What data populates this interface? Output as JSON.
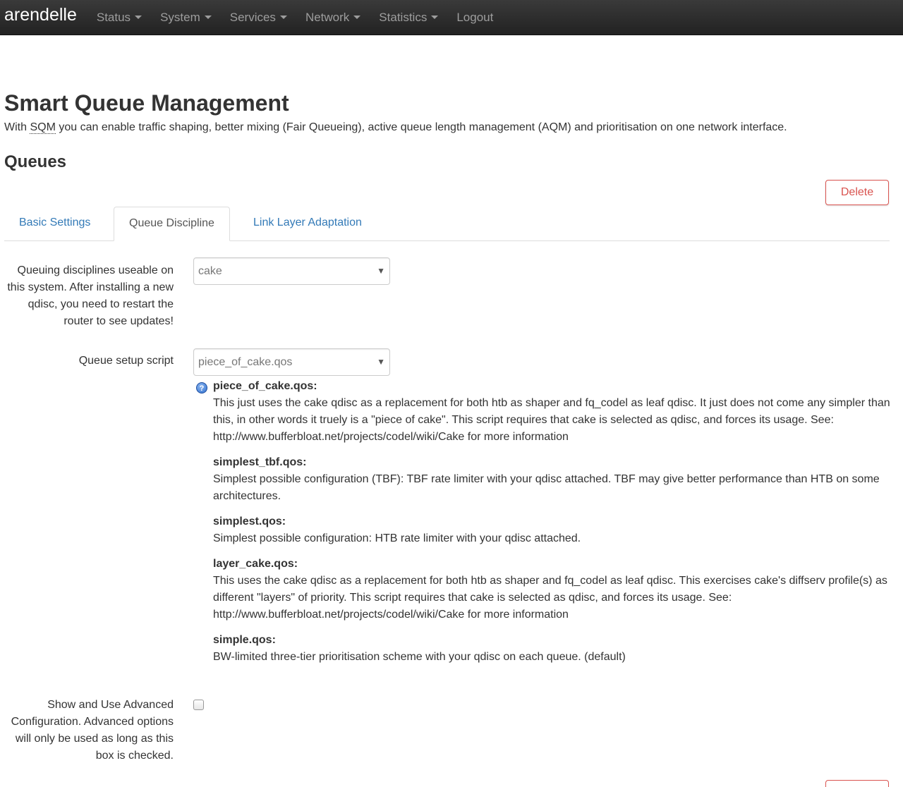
{
  "navbar": {
    "brand": "arendelle",
    "menu": [
      {
        "label": "Status",
        "dropdown": true
      },
      {
        "label": "System",
        "dropdown": true
      },
      {
        "label": "Services",
        "dropdown": true
      },
      {
        "label": "Network",
        "dropdown": true
      },
      {
        "label": "Statistics",
        "dropdown": true
      },
      {
        "label": "Logout",
        "dropdown": false
      }
    ]
  },
  "page": {
    "title": "Smart Queue Management",
    "description_before": "With ",
    "description_abbr": "SQM",
    "description_after": " you can enable traffic shaping, better mixing (Fair Queueing), active queue length management (AQM) and prioritisation on one network interface.",
    "section_title": "Queues",
    "delete_label": "Delete"
  },
  "tabs": [
    {
      "label": "Basic Settings",
      "active": false
    },
    {
      "label": "Queue Discipline",
      "active": true
    },
    {
      "label": "Link Layer Adaptation",
      "active": false
    }
  ],
  "form": {
    "qdisc_label": "Queuing disciplines useable on this system. After installing a new qdisc, you need to restart the router to see updates!",
    "qdisc_value": "cake",
    "script_label": "Queue setup script",
    "script_value": "piece_of_cake.qos",
    "advanced_label": "Show and Use Advanced Configuration. Advanced options will only be used as long as this box is checked.",
    "advanced_checked": false
  },
  "scripts_help": [
    {
      "name": "piece_of_cake.qos:",
      "text": "This just uses the cake qdisc as a replacement for both htb as shaper and fq_codel as leaf qdisc. It just does not come any simpler than this, in other words it truely is a \"piece of cake\". This script requires that cake is selected as qdisc, and forces its usage. See: http://www.bufferbloat.net/projects/codel/wiki/Cake for more information"
    },
    {
      "name": "simplest_tbf.qos:",
      "text": "Simplest possible configuration (TBF): TBF rate limiter with your qdisc attached. TBF may give better performance than HTB on some architectures."
    },
    {
      "name": "simplest.qos:",
      "text": "Simplest possible configuration: HTB rate limiter with your qdisc attached."
    },
    {
      "name": "layer_cake.qos:",
      "text": "This uses the cake qdisc as a replacement for both htb as shaper and fq_codel as leaf qdisc. This exercises cake's diffserv profile(s) as different \"layers\" of priority. This script requires that cake is selected as qdisc, and forces its usage. See: http://www.bufferbloat.net/projects/codel/wiki/Cake for more information"
    },
    {
      "name": "simple.qos:",
      "text": "BW-limited three-tier prioritisation scheme with your qdisc on each queue. (default)"
    }
  ],
  "icons": {
    "help": "help-question-icon",
    "dropdown": "chevron-down-icon"
  },
  "colors": {
    "link": "#337ab7",
    "danger": "#d9534f",
    "navbar": "#222222"
  }
}
